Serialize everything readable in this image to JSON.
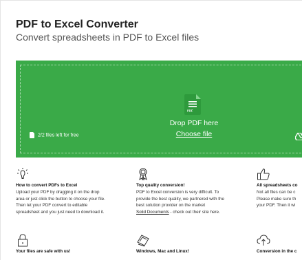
{
  "header": {
    "title": "PDF to Excel Converter",
    "subtitle": "Convert spreadsheets in PDF to Excel files"
  },
  "dropzone": {
    "drop_label": "Drop PDF here",
    "choose_file": "Choose file",
    "files_left": "2/2 files left for free",
    "file_icon_badge": "PDF",
    "accent_color": "#3aaa48",
    "icon_color": "#2e9a3c"
  },
  "features": [
    {
      "icon": "lightbulb-icon",
      "title": "How to convert PDFs to Excel",
      "lines": [
        "Upload your PDF by dragging it on the drop",
        "area or just click the button to choose your file.",
        "Then let your PDF convert to editable",
        "spreadsheet and you just need to download it."
      ]
    },
    {
      "icon": "award-ribbon-icon",
      "title": "Top quality conversion!",
      "lines": [
        "PDF to Excel conversion is very difficult. To",
        "provide the best quality, we partnered with the",
        "best solution provider on the market"
      ],
      "link_text": "Solid Documents",
      "link_suffix": " - check out their site here."
    },
    {
      "icon": "thumbs-up-icon",
      "title": "All spreadsheets co",
      "lines": [
        "Not all files can be c",
        "Please make sure th",
        "your PDF. Then it wi"
      ]
    },
    {
      "icon": "padlock-icon",
      "title": "Your files are safe with us!"
    },
    {
      "icon": "platforms-icon",
      "title": "Windows, Mac and Linux!"
    },
    {
      "icon": "cloud-upload-icon",
      "title": "Conversion in the c"
    }
  ]
}
